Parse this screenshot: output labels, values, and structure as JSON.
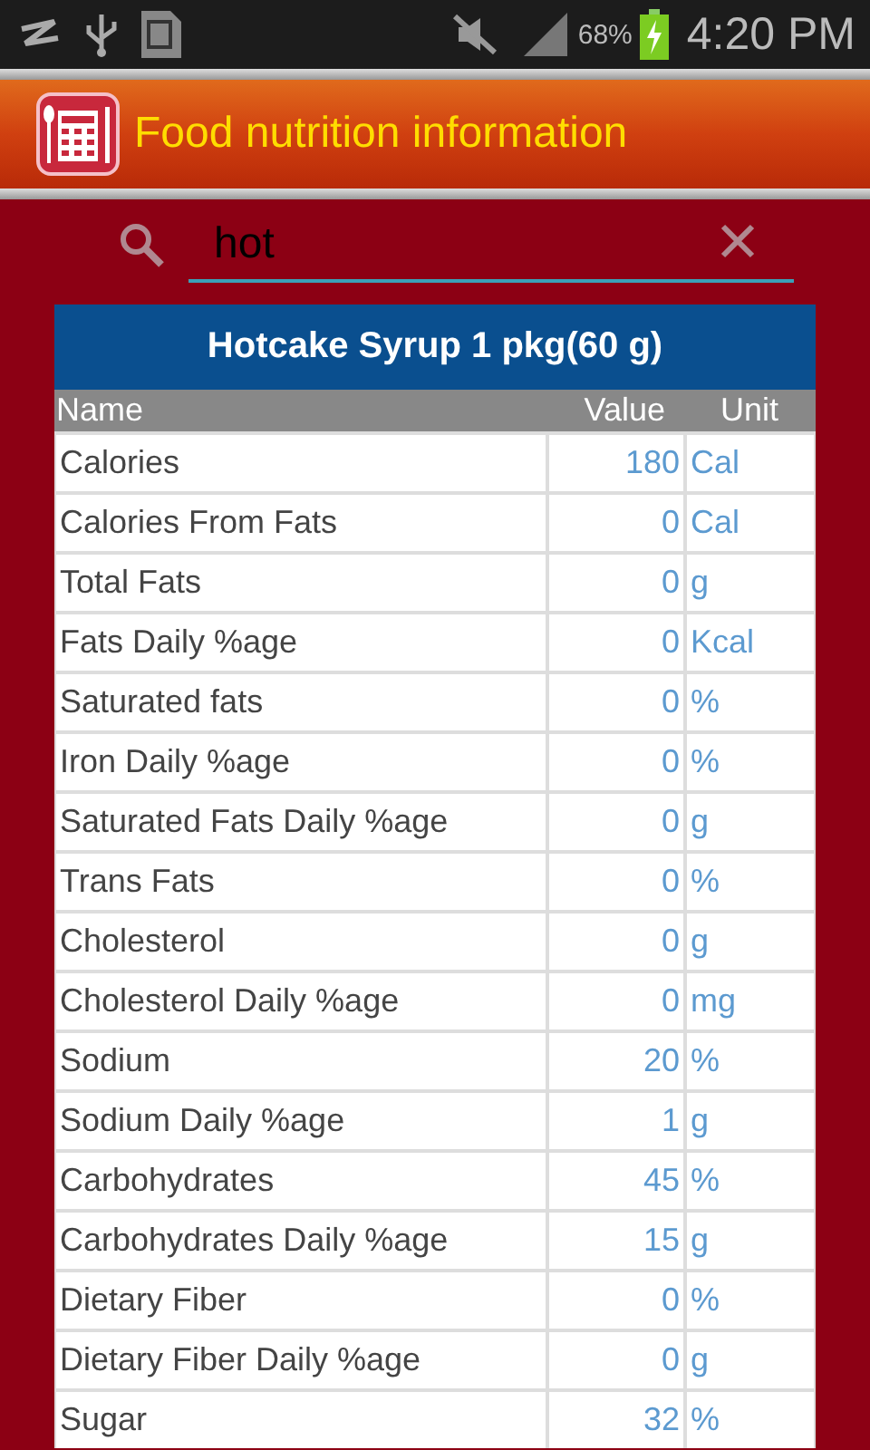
{
  "status_bar": {
    "battery": "68%",
    "time": "4:20 PM"
  },
  "app_bar": {
    "title": "Food nutrition information"
  },
  "search": {
    "value": "hot"
  },
  "table": {
    "title": "Hotcake Syrup 1 pkg(60 g)",
    "columns": [
      "Name",
      "Value",
      "Unit"
    ],
    "rows": [
      {
        "name": "Calories",
        "value": "180",
        "unit": "Cal"
      },
      {
        "name": "Calories From Fats",
        "value": "0",
        "unit": "Cal"
      },
      {
        "name": "Total Fats",
        "value": "0",
        "unit": "g"
      },
      {
        "name": "Fats Daily %age",
        "value": "0",
        "unit": "Kcal"
      },
      {
        "name": "Saturated fats",
        "value": "0",
        "unit": "%"
      },
      {
        "name": "Iron Daily %age",
        "value": "0",
        "unit": "%"
      },
      {
        "name": "Saturated Fats Daily %age",
        "value": "0",
        "unit": "g"
      },
      {
        "name": "Trans Fats",
        "value": "0",
        "unit": "%"
      },
      {
        "name": "Cholesterol",
        "value": "0",
        "unit": "g"
      },
      {
        "name": "Cholesterol Daily %age",
        "value": "0",
        "unit": "mg"
      },
      {
        "name": "Sodium",
        "value": "20",
        "unit": "%"
      },
      {
        "name": "Sodium Daily %age",
        "value": "1",
        "unit": "g"
      },
      {
        "name": "Carbohydrates",
        "value": "45",
        "unit": "%"
      },
      {
        "name": "Carbohydrates Daily %age",
        "value": "15",
        "unit": "g"
      },
      {
        "name": "Dietary Fiber",
        "value": "0",
        "unit": "%"
      },
      {
        "name": "Dietary Fiber Daily %age",
        "value": "0",
        "unit": "g"
      },
      {
        "name": "Sugar",
        "value": "32",
        "unit": "%"
      }
    ]
  }
}
